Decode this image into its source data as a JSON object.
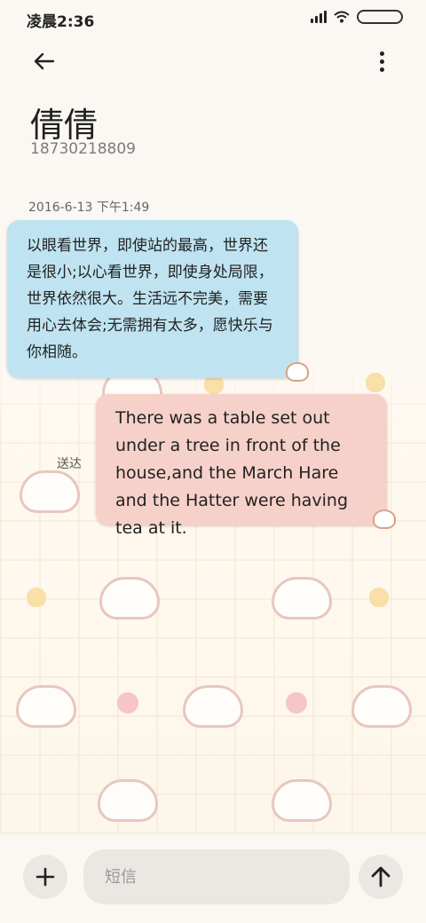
{
  "status_bar": {
    "time": "凌晨2:36"
  },
  "header": {
    "contact_name": "倩倩",
    "contact_number": "18730218809"
  },
  "conversation": {
    "timestamp": "2016-6-13 下午1:49",
    "messages": [
      {
        "direction": "incoming",
        "text": "以眼看世界，即使站的最高，世界还是很小;以心看世界，即使身处局限，世界依然很大。生活远不完美，需要用心去体会;无需拥有太多，愿快乐与你相随。"
      },
      {
        "direction": "outgoing",
        "text": "There was a table set out under a tree in front of the house,and the March Hare and the Hatter were having tea at it.",
        "status": "送达"
      }
    ]
  },
  "composer": {
    "placeholder": "短信",
    "add_icon": "plus-icon",
    "send_icon": "arrow-up-icon"
  },
  "colors": {
    "incoming_bubble": "#bfe3f1",
    "outgoing_bubble": "#f6d1c9",
    "background": "#fbf8f3"
  }
}
